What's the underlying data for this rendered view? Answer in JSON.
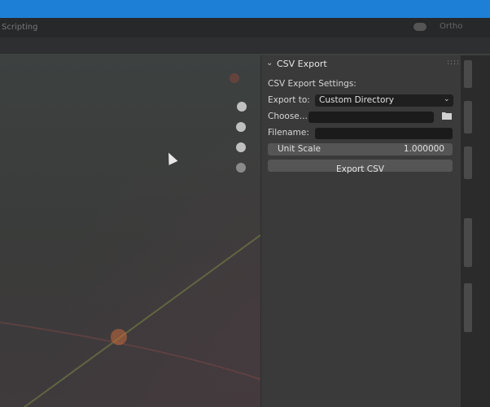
{
  "topbar": {
    "menu_label": "Scripting",
    "toggle_label": "Ortho"
  },
  "panel": {
    "title": "CSV Export",
    "settings_label": "CSV Export Settings:",
    "export_to_label": "Export to:",
    "export_to_value": "Custom Directory",
    "choose_label": "Choose...",
    "choose_value": "",
    "filename_label": "Filename:",
    "filename_value": "",
    "unit_scale_label": "Unit Scale",
    "unit_scale_value": "1.000000",
    "export_button": "Export CSV"
  },
  "colors": {
    "titlebar": "#1e7fd6",
    "panel_bg": "#3a3a3a",
    "field_bg": "#1b1b1b",
    "button_bg": "#555555"
  },
  "icons": [
    "chevron-down-icon",
    "drag-handle-icon",
    "dropdown-arrow-icon",
    "folder-icon",
    "move-view-icon",
    "zoom-icon",
    "camera-icon",
    "ortho-toggle-icon"
  ]
}
